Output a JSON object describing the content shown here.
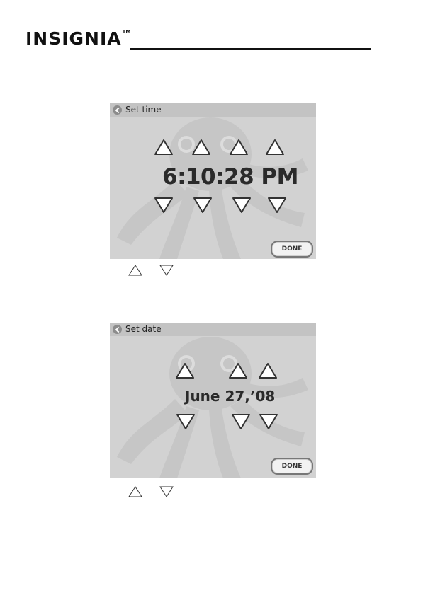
{
  "header": {
    "logo_text": "INSIGNIA",
    "logo_tm": "TM"
  },
  "time_screen": {
    "title": "Set time",
    "value": "6:10:28 PM",
    "done_label": "DONE",
    "up_arrows": [
      "hour",
      "minute",
      "second",
      "ampm"
    ],
    "down_arrows": [
      "hour",
      "minute",
      "second",
      "ampm"
    ]
  },
  "date_screen": {
    "title": "Set date",
    "value": "June 27,’08",
    "done_label": "DONE",
    "up_arrows": [
      "month",
      "day",
      "year"
    ],
    "down_arrows": [
      "month",
      "day",
      "year"
    ]
  },
  "captions": {
    "icons": [
      "up-triangle-outline",
      "down-triangle-outline"
    ]
  },
  "colors": {
    "screen_bg": "#d2d2d2",
    "titlebar_bg": "#c3c3c3",
    "arrow_fill": "#ffffff",
    "arrow_stroke": "#333333"
  }
}
